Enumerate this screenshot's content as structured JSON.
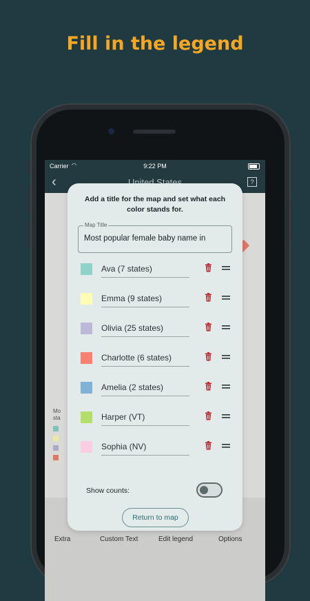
{
  "headline": "Fill in the legend",
  "status_bar": {
    "carrier": "Carrier",
    "time": "9:22 PM"
  },
  "nav": {
    "title": "United States"
  },
  "background": {
    "legend_partial": "Mo sta",
    "toolbar_labels": [
      "Extra",
      "Custom Text",
      "Edit legend",
      "Options"
    ]
  },
  "modal": {
    "instructions": "Add a title for the map and set what each color stands for.",
    "map_title_label": "Map Title",
    "map_title_value": "Most popular female baby name in",
    "legend_items": [
      {
        "label": "Ava (7 states)",
        "color": "#8fd3c8"
      },
      {
        "label": "Emma (9 states)",
        "color": "#fdfdb3"
      },
      {
        "label": "Olivia (25 states)",
        "color": "#bcb8d9"
      },
      {
        "label": "Charlotte (6 states)",
        "color": "#f7816f"
      },
      {
        "label": "Amelia (2 states)",
        "color": "#7fb2d6"
      },
      {
        "label": "Harper (VT)",
        "color": "#b3de69"
      },
      {
        "label": "Sophia (NV)",
        "color": "#fbcde4"
      }
    ],
    "show_counts_label": "Show counts:",
    "show_counts_on": false,
    "return_button": "Return to map"
  }
}
